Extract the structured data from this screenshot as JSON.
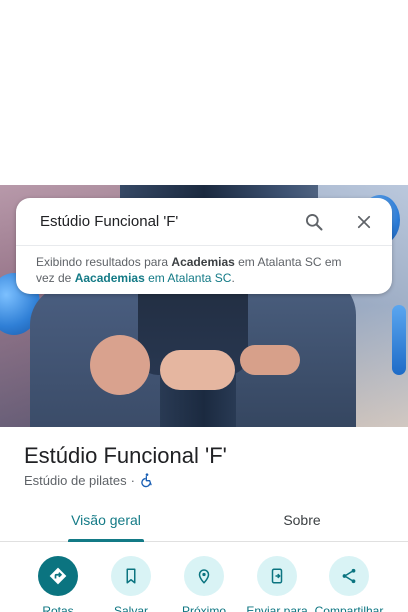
{
  "search": {
    "query": "Estúdio Funcional 'F'",
    "note_prefix": "Exibindo resultados para ",
    "note_term": "Academias",
    "note_location1": " em Atalanta SC em",
    "note_instead": "vez de ",
    "note_original": "Aacademias",
    "note_location2": " em Atalanta SC",
    "note_period": "."
  },
  "place": {
    "title": "Estúdio Funcional 'F'",
    "category": "Estúdio de pilates",
    "separator": "·"
  },
  "tabs": [
    {
      "label": "Visão geral",
      "active": true
    },
    {
      "label": "Sobre",
      "active": false
    }
  ],
  "actions": [
    {
      "label": "Rotas",
      "icon": "directions-icon"
    },
    {
      "label": "Salvar",
      "icon": "bookmark-icon"
    },
    {
      "label": "Próximo",
      "icon": "nearby-icon"
    },
    {
      "label": "Enviar para",
      "icon": "send-to-phone-icon"
    },
    {
      "label": "Compartilhar",
      "icon": "share-icon"
    }
  ],
  "colors": {
    "accent": "#0b7480",
    "accent_light": "#d9f3f5",
    "link": "#137a86"
  }
}
